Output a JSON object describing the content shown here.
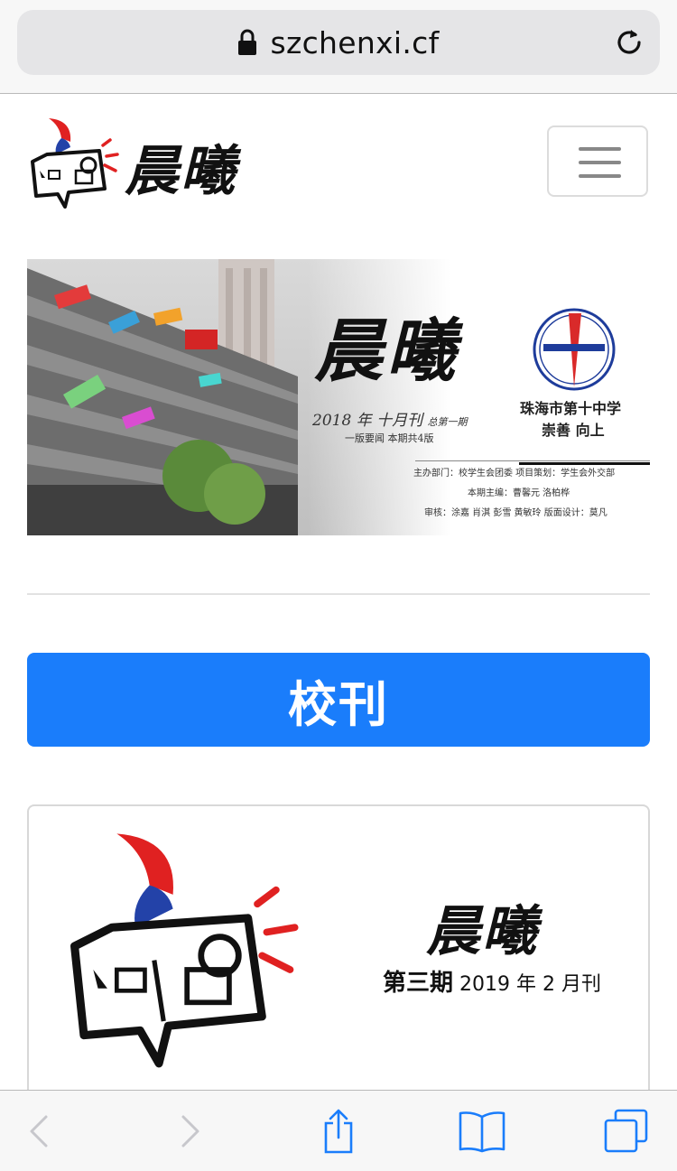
{
  "browser": {
    "url": "szchenxi.cf",
    "icons": {
      "lock": "lock-icon",
      "reload": "reload-icon"
    },
    "toolbar": [
      "back-arrow-icon",
      "forward-arrow-icon",
      "share-icon",
      "bookmarks-icon",
      "tabs-icon"
    ],
    "accent_color": "#1a7dfb"
  },
  "navbar": {
    "brand_title": "晨曦",
    "menu_icon": "hamburger-menu-icon"
  },
  "banner": {
    "title": "晨曦",
    "issue_line": "2018 年  十月刊",
    "issue_total": "总第一期",
    "issue_sub": "一版要闻 本期共4版",
    "school_name": "珠海市第十中学",
    "motto": "崇善 向上",
    "credits_1": "主办部门：校学生会团委  项目策划：学生会外交部",
    "credits_2": "本期主编：曹馨元 洛柏桦",
    "credits_3": "审核：涂嘉 肖淇 彭雪 黄敏玲  版面设计：莫凡"
  },
  "main": {
    "button_label": "校刊"
  },
  "card": {
    "title": "晨曦",
    "issue_prefix": "第三期",
    "issue_date": "2019 年 2 月刊"
  }
}
